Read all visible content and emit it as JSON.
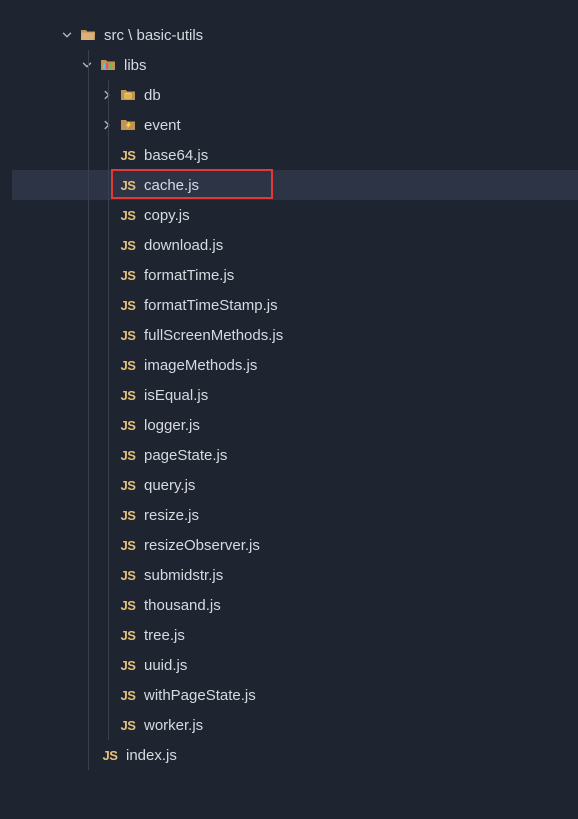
{
  "tree": {
    "root": {
      "name": "src \\ basic-utils",
      "open": true,
      "icon": "folder-root"
    },
    "libs": {
      "name": "libs",
      "open": true,
      "icon": "folder-libs"
    },
    "folders": [
      {
        "name": "db",
        "icon": "db"
      },
      {
        "name": "event",
        "icon": "event"
      }
    ],
    "files": [
      {
        "name": "base64.js"
      },
      {
        "name": "cache.js",
        "selected": true,
        "highlighted": true
      },
      {
        "name": "copy.js"
      },
      {
        "name": "download.js"
      },
      {
        "name": "formatTime.js"
      },
      {
        "name": "formatTimeStamp.js"
      },
      {
        "name": "fullScreenMethods.js"
      },
      {
        "name": "imageMethods.js"
      },
      {
        "name": "isEqual.js"
      },
      {
        "name": "logger.js"
      },
      {
        "name": "pageState.js"
      },
      {
        "name": "query.js"
      },
      {
        "name": "resize.js"
      },
      {
        "name": "resizeObserver.js"
      },
      {
        "name": "submidstr.js"
      },
      {
        "name": "thousand.js"
      },
      {
        "name": "tree.js"
      },
      {
        "name": "uuid.js"
      },
      {
        "name": "withPageState.js"
      },
      {
        "name": "worker.js"
      }
    ],
    "rootFiles": [
      {
        "name": "index.js"
      }
    ]
  }
}
